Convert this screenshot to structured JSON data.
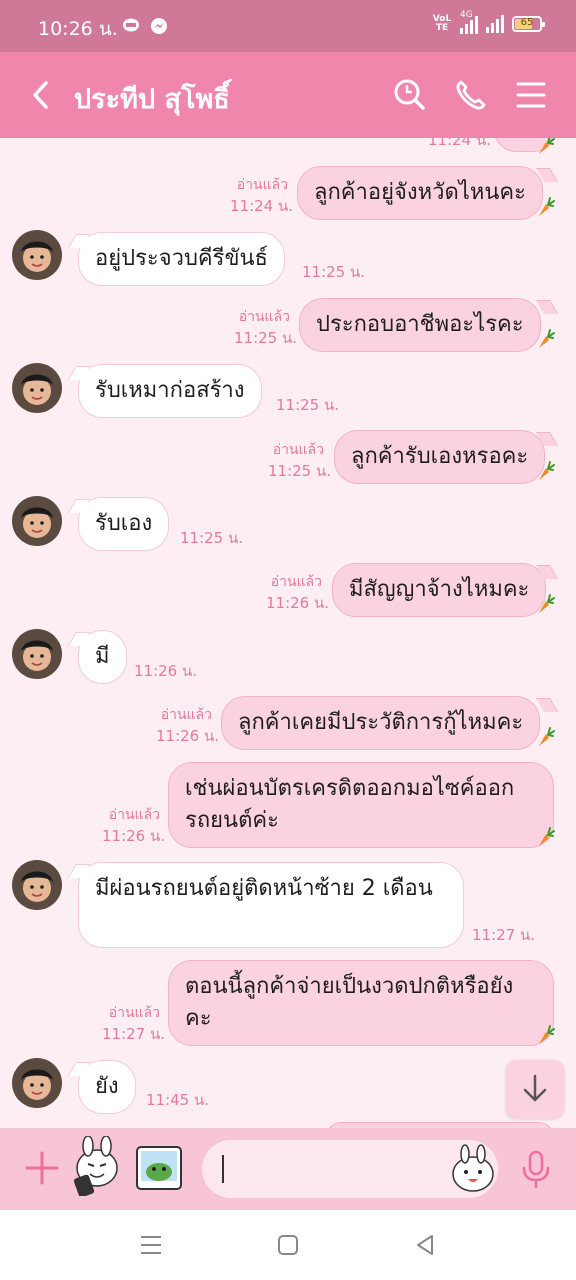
{
  "status_bar": {
    "time": "10:26 น.",
    "network": "4G",
    "volte": "VoLTE",
    "battery": "65"
  },
  "header": {
    "contact_name": "ประทีป สุโพธิ์"
  },
  "messages": [
    {
      "id": "m0",
      "side": "out",
      "text": "",
      "time": "11:24 น.",
      "read": ""
    },
    {
      "id": "m1",
      "side": "out",
      "text": "ลูกค้าอยู่จังหวัดไหนคะ",
      "time": "11:24 น.",
      "read": "อ่านแล้ว"
    },
    {
      "id": "m2",
      "side": "in",
      "text": "อยู่ประจวบคีรีขันธ์",
      "time": "11:25 น."
    },
    {
      "id": "m3",
      "side": "out",
      "text": "ประกอบอาชีพอะไรคะ",
      "time": "11:25 น.",
      "read": "อ่านแล้ว"
    },
    {
      "id": "m4",
      "side": "in",
      "text": "รับเหมาก่อสร้าง",
      "time": "11:25 น."
    },
    {
      "id": "m5",
      "side": "out",
      "text": "ลูกค้ารับเองหรอคะ",
      "time": "11:25 น.",
      "read": "อ่านแล้ว"
    },
    {
      "id": "m6",
      "side": "in",
      "text": "รับเอง",
      "time": "11:25 น."
    },
    {
      "id": "m7",
      "side": "out",
      "text": "มีสัญญาจ้างไหมคะ",
      "time": "11:26 น.",
      "read": "อ่านแล้ว"
    },
    {
      "id": "m8",
      "side": "in",
      "text": "มี",
      "time": "11:26 น."
    },
    {
      "id": "m9",
      "side": "out",
      "text": "ลูกค้าเคยมีประวัติการกู้ไหมคะ",
      "time": "11:26 น.",
      "read": "อ่านแล้ว"
    },
    {
      "id": "m10",
      "side": "out",
      "text": "เช่นผ่อนบัตรเครดิตออกมอไซค์ออกรถยนต์ค่ะ",
      "time": "11:26 น.",
      "read": "อ่านแล้ว"
    },
    {
      "id": "m11",
      "side": "in",
      "text": "มีผ่อนรถยนต์อยู่ติดหน้าซ้าย 2 เดือน",
      "time": "11:27 น."
    },
    {
      "id": "m12",
      "side": "out",
      "text": "ตอนนี้ลูกค้าจ่ายเป็นงวดปกติหรือยังคะ",
      "time": "11:27 น.",
      "read": "อ่านแล้ว"
    },
    {
      "id": "m13",
      "side": "in",
      "text": "ยัง",
      "time": "11:45 น."
    }
  ],
  "input": {
    "placeholder": "",
    "value": ""
  },
  "colors": {
    "header": "#f186ad",
    "status_bar": "#cf7898",
    "chat_bg": "#fdeef3",
    "bubble_out": "#fbd2e0",
    "accent": "#e5799e"
  },
  "icons": [
    "back-icon",
    "search-icon",
    "phone-icon",
    "menu-icon",
    "carrot-icon",
    "plus-icon",
    "sticker-icon",
    "gallery-icon",
    "emoji-icon",
    "mic-icon",
    "arrow-down-icon"
  ]
}
